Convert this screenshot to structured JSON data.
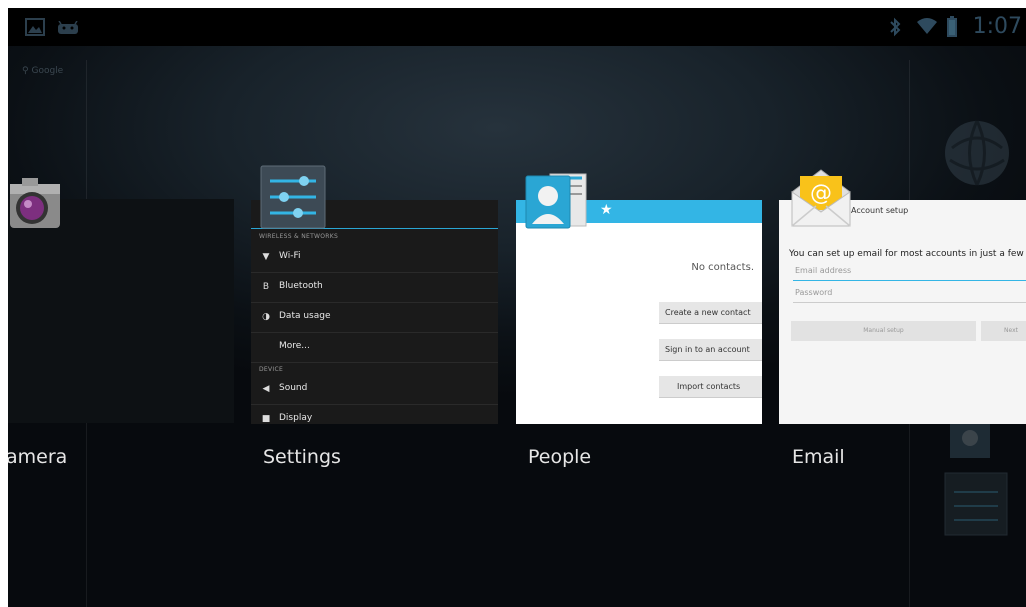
{
  "status_bar": {
    "time": "1:07",
    "left_icons": [
      "gallery-icon",
      "android-icon"
    ],
    "right_icons": [
      "bluetooth-icon",
      "wifi-icon",
      "battery-icon"
    ]
  },
  "search_hint": "Google",
  "recents": [
    {
      "id": "camera",
      "label": "amera",
      "icon": "camera-icon"
    },
    {
      "id": "settings",
      "label": "Settings",
      "icon": "settings-icon",
      "thumb": {
        "category_1": "WIRELESS & NETWORKS",
        "rows_1": [
          {
            "icon": "wifi-icon",
            "glyph": "▼",
            "label": "Wi-Fi"
          },
          {
            "icon": "bluetooth-icon",
            "glyph": "B",
            "label": "Bluetooth"
          },
          {
            "icon": "data-usage-icon",
            "glyph": "◑",
            "label": "Data usage"
          },
          {
            "icon": "",
            "glyph": "",
            "label": "More..."
          }
        ],
        "category_2": "DEVICE",
        "rows_2": [
          {
            "icon": "sound-icon",
            "glyph": "◀",
            "label": "Sound"
          },
          {
            "icon": "display-icon",
            "glyph": "■",
            "label": "Display"
          }
        ]
      }
    },
    {
      "id": "people",
      "label": "People",
      "icon": "people-icon",
      "thumb": {
        "empty_text": "No contacts.",
        "buttons": [
          "Create a new contact",
          "Sign in to an account",
          "Import contacts"
        ]
      }
    },
    {
      "id": "email",
      "label": "Email",
      "icon": "email-icon",
      "thumb": {
        "title": "Account setup",
        "intro": "You can set up email for most accounts in just a few steps.",
        "email_placeholder": "Email address",
        "password_placeholder": "Password",
        "manual_setup": "Manual setup",
        "next": "Next"
      }
    }
  ],
  "colors": {
    "accent": "#33b5e5",
    "status_bar_icons": "#2e4a5e"
  }
}
